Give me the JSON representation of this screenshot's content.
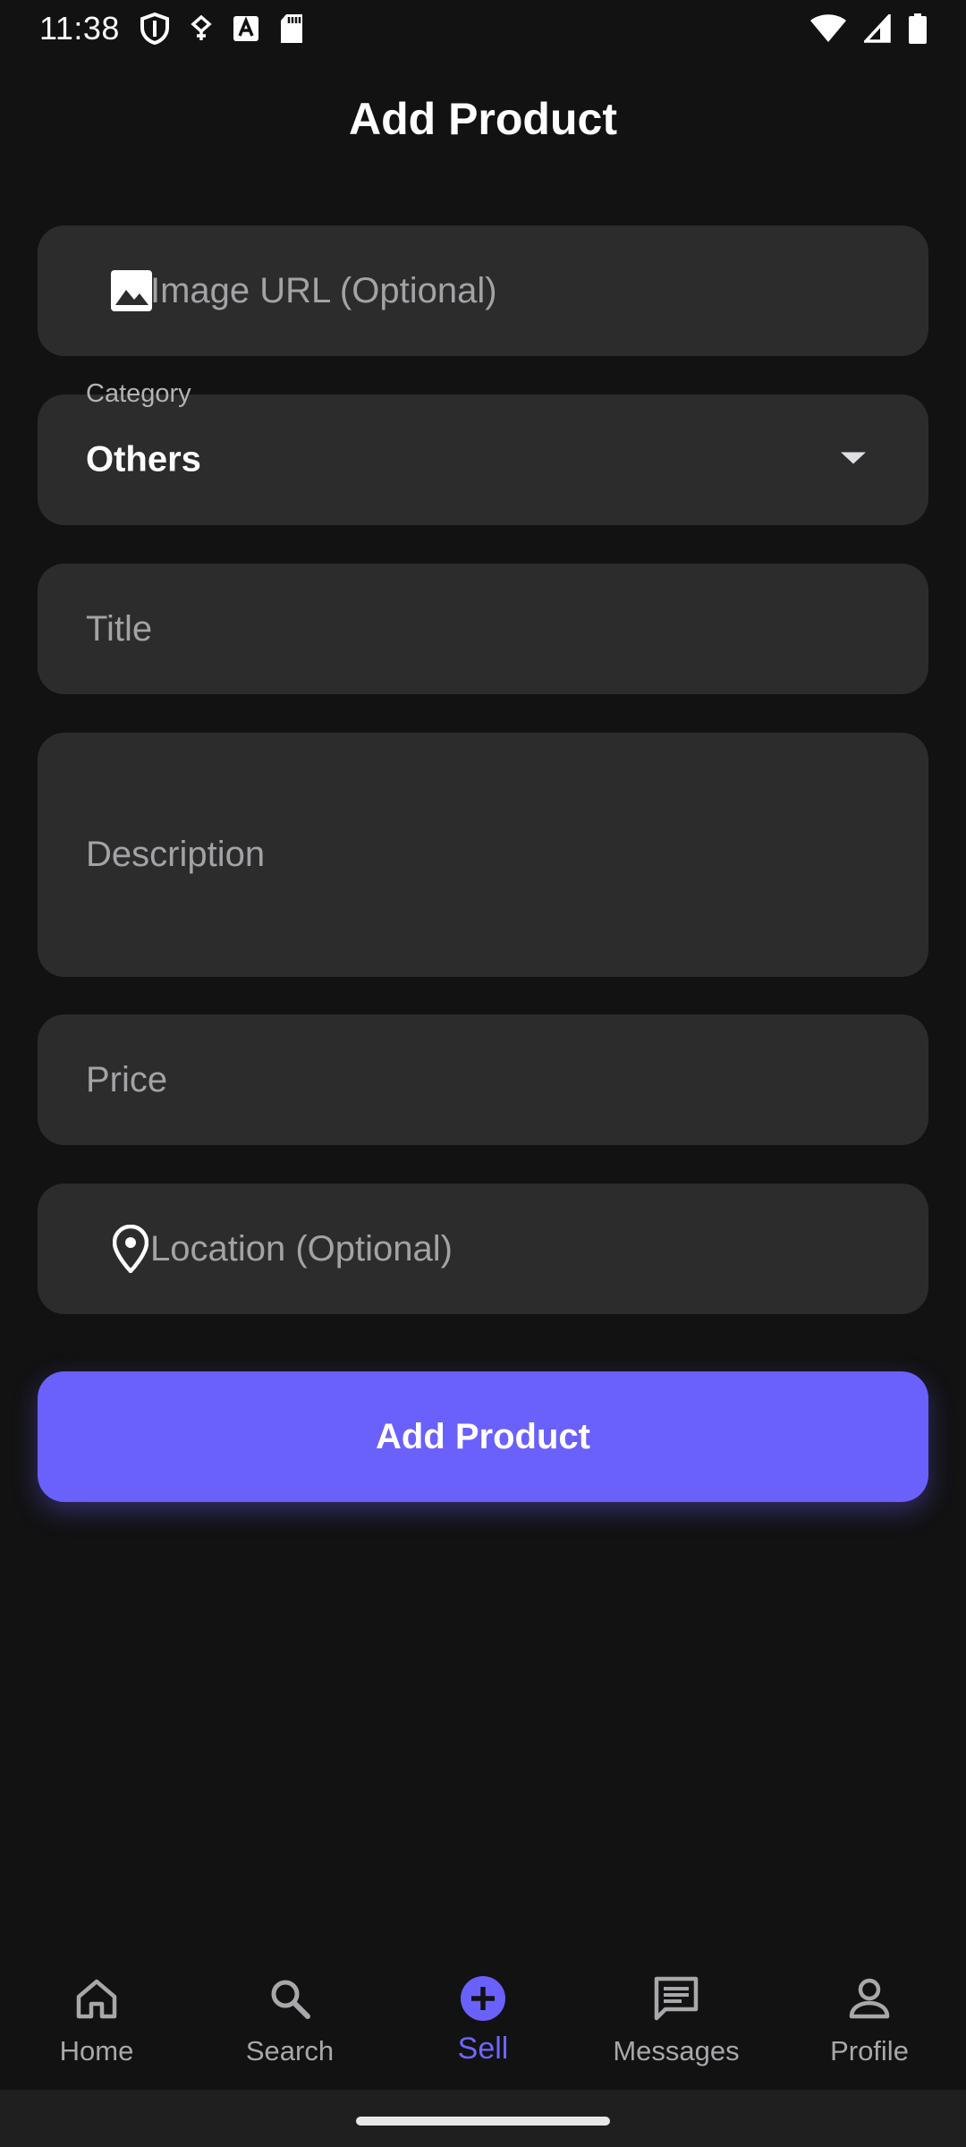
{
  "status_bar": {
    "time": "11:38",
    "icons": [
      "shield-icon",
      "vpn-key-icon",
      "text-a-icon",
      "sd-card-icon",
      "wifi-icon",
      "signal-icon",
      "battery-icon"
    ]
  },
  "page": {
    "title": "Add Product"
  },
  "form": {
    "image_url": {
      "placeholder": "Image URL (Optional)",
      "icon": "image-icon"
    },
    "category": {
      "label": "Category",
      "value": "Others"
    },
    "title": {
      "placeholder": "Title"
    },
    "description": {
      "placeholder": "Description"
    },
    "price": {
      "placeholder": "Price"
    },
    "location": {
      "placeholder": "Location (Optional)",
      "icon": "location-pin-icon"
    },
    "submit_label": "Add Product"
  },
  "nav": {
    "items": [
      {
        "label": "Home",
        "icon": "home-icon"
      },
      {
        "label": "Search",
        "icon": "search-icon"
      },
      {
        "label": "Sell",
        "icon": "add-circle-icon",
        "active": true
      },
      {
        "label": "Messages",
        "icon": "messages-icon"
      },
      {
        "label": "Profile",
        "icon": "profile-icon"
      }
    ]
  },
  "colors": {
    "background": "#121213",
    "field": "#2c2c2d",
    "accent": "#6a60fb",
    "placeholder": "#a3a3a6"
  }
}
